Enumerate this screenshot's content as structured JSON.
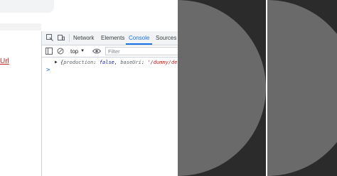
{
  "devtools": {
    "tabs": [
      {
        "label": "Network"
      },
      {
        "label": "Elements"
      },
      {
        "label": "Console",
        "active": true
      },
      {
        "label": "Sources"
      }
    ],
    "toolbar": {
      "context": "top",
      "filter_placeholder": "Filter"
    },
    "console": {
      "object_open": "{",
      "key1": "production",
      "value1": "false",
      "key2": "baseUri",
      "value2": "'/dummy/dev/api/",
      "prompt": ">"
    }
  },
  "page": {
    "link_text": "Url"
  },
  "colors": {
    "active_tab": "#1a73e8",
    "link": "#c5221f",
    "dark_panel": "#2b2b2b",
    "circle": "#6a6a6a"
  }
}
